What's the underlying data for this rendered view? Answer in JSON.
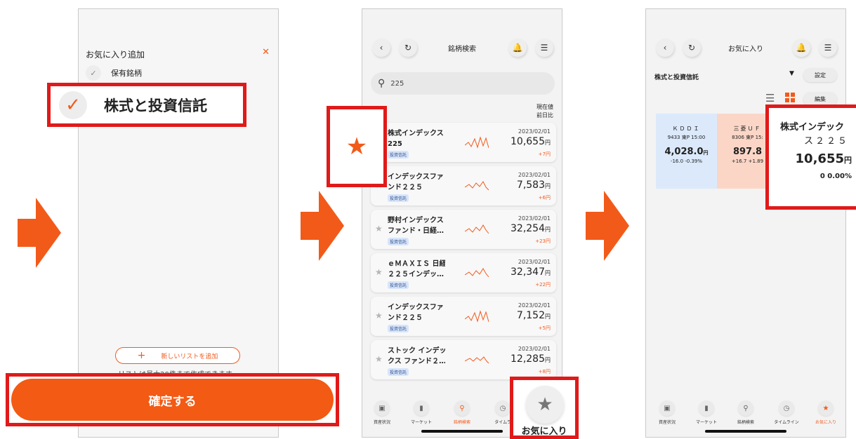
{
  "colors": {
    "accent": "#f25a1a",
    "highlight_border": "#e01a1a",
    "tile_kddi": "#dbe9fb",
    "tile_mufg": "#fbd6c7"
  },
  "step1": {
    "title": "お気に入り追加",
    "close_icon": "close-x",
    "option_label": "保有銘柄",
    "highlight_label": "株式と投資信託",
    "add_list_label": "新しいリストを追加",
    "note": "リストは最大20件まで作成できます。",
    "confirm_label": "確定する"
  },
  "step2": {
    "title": "銘柄検索",
    "search_value": "225",
    "col_head_1": "現在値",
    "col_head_2": "前日比",
    "results": [
      {
        "name1": "株式インデックス",
        "name2": "225",
        "tag": "投資信託",
        "date": "2023/02/01",
        "price": "10,655",
        "unit": "円",
        "change": "+7円"
      },
      {
        "name1": "インデックスファ",
        "name2": "ンド２２５",
        "tag": "投資信託",
        "date": "2023/02/01",
        "price": "7,583",
        "unit": "円",
        "change": "+6円"
      },
      {
        "name1": "野村インデックス",
        "name2": "ファンド・日経…",
        "tag": "投資信託",
        "date": "2023/02/01",
        "price": "32,254",
        "unit": "円",
        "change": "+23円"
      },
      {
        "name1": "ｅＭＡＸＩＳ 日経",
        "name2": "２２５インデッ…",
        "tag": "投資信託",
        "date": "2023/02/01",
        "price": "32,347",
        "unit": "円",
        "change": "+22円"
      },
      {
        "name1": "インデックスファ",
        "name2": "ンド２２５",
        "tag": "投資信託",
        "date": "2023/02/01",
        "price": "7,152",
        "unit": "円",
        "change": "+5円"
      },
      {
        "name1": "ストック インデッ",
        "name2": "クス ファンド２…",
        "tag": "投資信託",
        "date": "2023/02/01",
        "price": "12,285",
        "unit": "円",
        "change": "+8円"
      }
    ],
    "tabs": [
      "資産状況",
      "マーケット",
      "銘柄検索",
      "タイムラ"
    ],
    "fav_label": "お気に入り"
  },
  "step3": {
    "title": "お気に入り",
    "list_name": "株式と投資信託",
    "settings_label": "設定",
    "edit_label": "編集",
    "tiles": [
      {
        "name": "ＫＤＤＩ",
        "code": "9433 東P 15:00",
        "price": "4,028.0",
        "unit": "円",
        "change": "-16.0 -0.39%"
      },
      {
        "name": "三菱ＵＦ",
        "code": "8306 東P 15:",
        "price": "897.8",
        "unit": "",
        "change": "+16.7 +1.89"
      }
    ],
    "highlight_tile": {
      "name1": "株式インデック",
      "name2": "ス２２５",
      "price": "10,655",
      "unit": "円",
      "change": "0 0.00%"
    },
    "tabs": [
      "資産状況",
      "マーケット",
      "銘柄検索",
      "タイムライン",
      "お気に入り"
    ]
  }
}
